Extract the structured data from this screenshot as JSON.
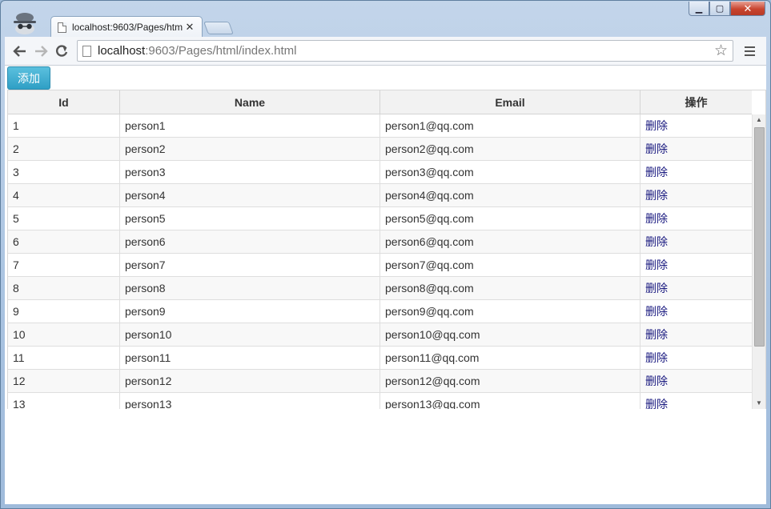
{
  "browser": {
    "tab_title": "localhost:9603/Pages/htm",
    "tab_close": "✕",
    "url_host": "localhost",
    "url_rest": ":9603/Pages/html/index.html",
    "icons": {
      "back": "back-arrow-icon",
      "forward": "forward-arrow-icon",
      "reload": "reload-icon",
      "bookmark": "star-icon",
      "menu": "hamburger-menu-icon"
    }
  },
  "window_controls": {
    "minimize": "▁",
    "maximize": "▢",
    "close": "✕"
  },
  "toolbar": {
    "add_label": "添加",
    "add_color": "#3aa9d0"
  },
  "grid": {
    "columns": [
      "Id",
      "Name",
      "Email",
      "操作"
    ],
    "delete_label": "删除",
    "rows": [
      {
        "id": "1",
        "name": "person1",
        "email": "person1@qq.com"
      },
      {
        "id": "2",
        "name": "person2",
        "email": "person2@qq.com"
      },
      {
        "id": "3",
        "name": "person3",
        "email": "person3@qq.com"
      },
      {
        "id": "4",
        "name": "person4",
        "email": "person4@qq.com"
      },
      {
        "id": "5",
        "name": "person5",
        "email": "person5@qq.com"
      },
      {
        "id": "6",
        "name": "person6",
        "email": "person6@qq.com"
      },
      {
        "id": "7",
        "name": "person7",
        "email": "person7@qq.com"
      },
      {
        "id": "8",
        "name": "person8",
        "email": "person8@qq.com"
      },
      {
        "id": "9",
        "name": "person9",
        "email": "person9@qq.com"
      },
      {
        "id": "10",
        "name": "person10",
        "email": "person10@qq.com"
      },
      {
        "id": "11",
        "name": "person11",
        "email": "person11@qq.com"
      },
      {
        "id": "12",
        "name": "person12",
        "email": "person12@qq.com"
      },
      {
        "id": "13",
        "name": "person13",
        "email": "person13@qq.com"
      }
    ]
  }
}
